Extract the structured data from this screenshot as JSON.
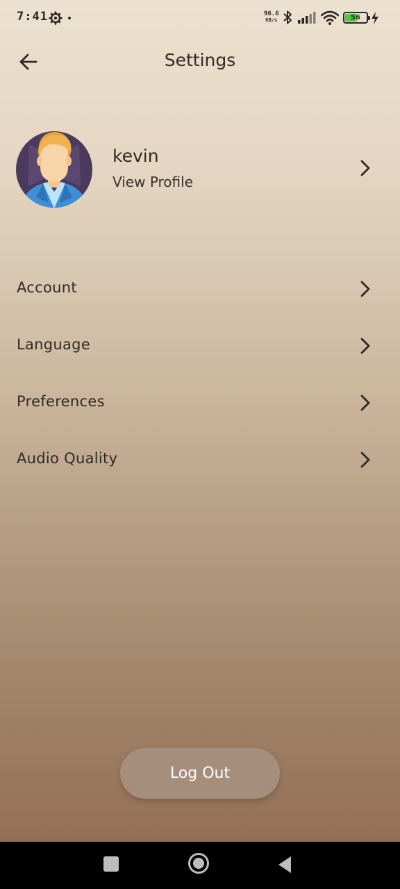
{
  "status_bar": {
    "time": "7:41",
    "speed_value": "96.6",
    "speed_unit": "KB/s",
    "battery_level": "56",
    "battery_fraction": 0.56,
    "battery_color": "#5bc24a"
  },
  "header": {
    "title": "Settings",
    "back_icon": "arrow-left-icon"
  },
  "profile": {
    "name": "kevin",
    "subtitle": "View Profile",
    "avatar_icon": "user-avatar"
  },
  "menu": {
    "items": [
      {
        "label": "Account"
      },
      {
        "label": "Language"
      },
      {
        "label": "Preferences"
      },
      {
        "label": "Audio Quality"
      }
    ],
    "chevron_icon": "chevron-right-icon"
  },
  "logout": {
    "label": "Log Out",
    "color": "#a58e7c"
  },
  "nav_bar": {
    "buttons": [
      "recents-icon",
      "home-icon",
      "back-icon"
    ]
  }
}
